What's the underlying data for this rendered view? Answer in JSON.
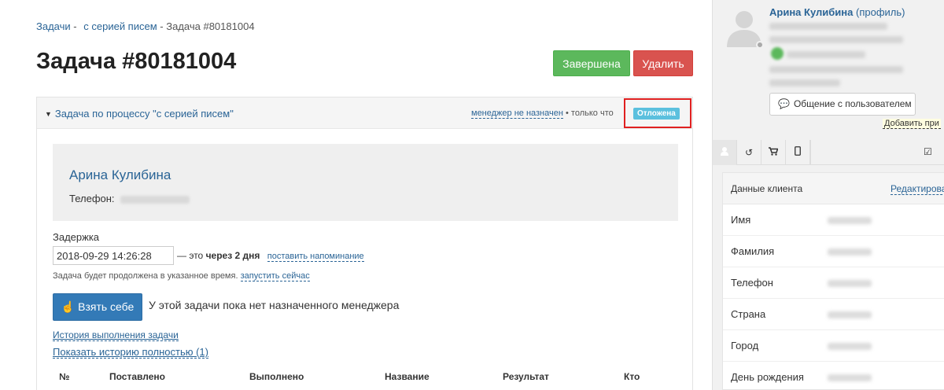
{
  "breadcrumb": {
    "item1": "Задачи",
    "sep1": "-",
    "item2": "с серией писем",
    "sep2": "-",
    "current": "Задача #80181004"
  },
  "page": {
    "title": "Задача #80181004"
  },
  "actions": {
    "done": "Завершена",
    "delete": "Удалить"
  },
  "task_panel": {
    "title": "Задача по процессу \"с серией писем\"",
    "manager_link": "менеджер не назначен",
    "meta_tail": "• только что",
    "status_badge": "Отложена"
  },
  "client_card": {
    "name": "Арина Кулибина",
    "phone_label": "Телефон:"
  },
  "delay": {
    "label": "Задержка",
    "value": "2018-09-29 14:26:28",
    "dash_prefix": "— это",
    "relative": "через 2 дня",
    "reminder_link": "поставить напоминание",
    "note": "Задача будет продолжена в указанное время.",
    "run_now_link": "запустить сейчас"
  },
  "take": {
    "button": "Взять себе",
    "no_manager": "У этой задачи пока нет назначенного менеджера"
  },
  "history": {
    "label": "История выполнения задачи",
    "show_full": "Показать историю полностью (1)"
  },
  "table": {
    "columns": [
      "№",
      "Поставлено",
      "Выполнено",
      "Название",
      "Результат",
      "Кто"
    ]
  },
  "sidebar": {
    "user_name": "Арина Кулибина",
    "profile_link": "(профиль)",
    "chat_button": "Общение с пользователем",
    "tooltip": "Добавить при"
  },
  "client_info": {
    "title": "Данные клиента",
    "edit_link": "Редактирова",
    "fields": [
      "Имя",
      "Фамилия",
      "Телефон",
      "Страна",
      "Город",
      "День рождения"
    ]
  },
  "colors": {
    "green": "#5cb85c",
    "red": "#d9534f",
    "blue": "#337ab7",
    "badge": "#5bc0de",
    "highlight": "#e02020"
  }
}
